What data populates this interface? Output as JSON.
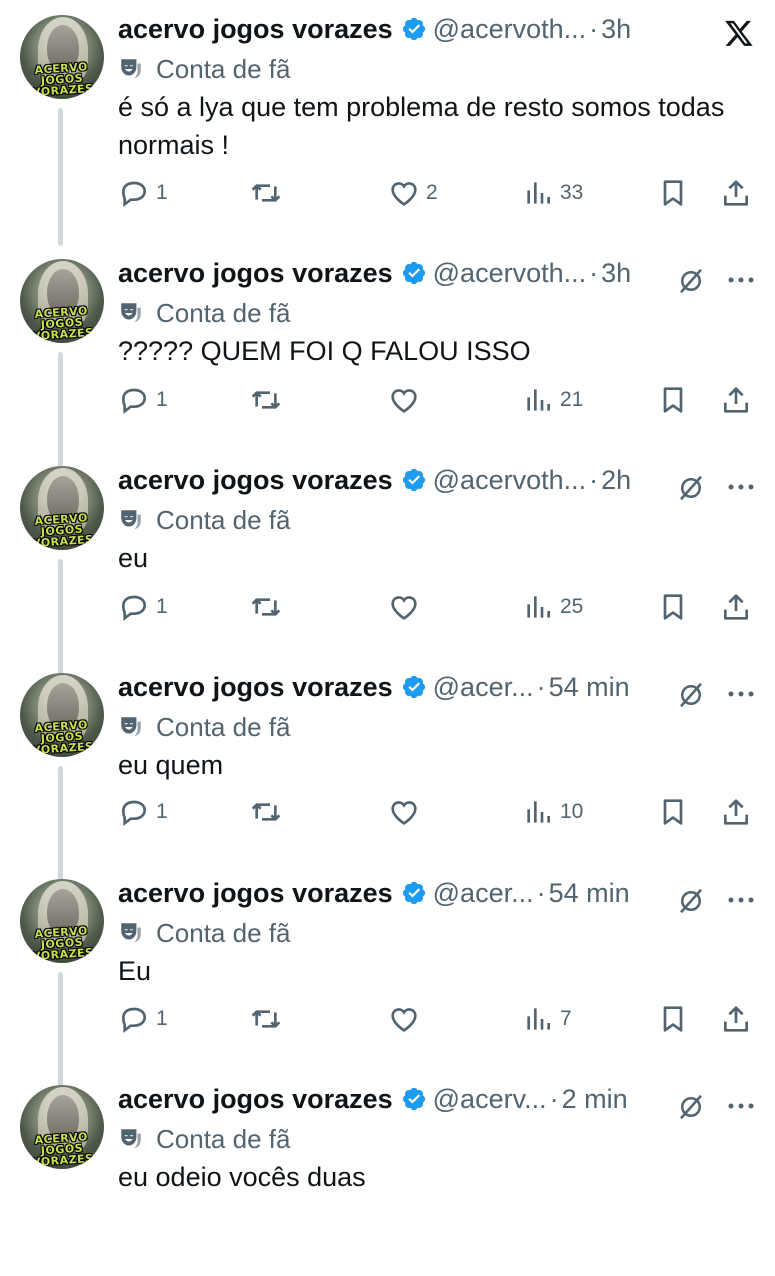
{
  "tweets": [
    {
      "name": "acervo jogos vorazes",
      "handle": "@acervoth...",
      "time": "3h",
      "fan_label": "Conta de fã",
      "text": "é só a lya que tem problema de resto somos todas normais !",
      "replies": "1",
      "reposts": "",
      "likes": "2",
      "views": "33",
      "corner_icon": "x-logo-icon",
      "avatar_text": "ACERVO JOGOS VORAZES"
    },
    {
      "name": "acervo jogos vorazes",
      "handle": "@acervoth...",
      "time": "3h",
      "fan_label": "Conta de fã",
      "text": "????? QUEM FOI Q FALOU ISSO",
      "replies": "1",
      "reposts": "",
      "likes": "",
      "views": "21",
      "corner_icon": "grok-icon",
      "avatar_text": "ACERVO JOGOS VORAZES"
    },
    {
      "name": "acervo jogos vorazes",
      "handle": "@acervoth...",
      "time": "2h",
      "fan_label": "Conta de fã",
      "text": "eu",
      "replies": "1",
      "reposts": "",
      "likes": "",
      "views": "25",
      "corner_icon": "grok-icon",
      "avatar_text": "ACERVO JOGOS VORAZES"
    },
    {
      "name": "acervo jogos vorazes",
      "handle": "@acer...",
      "time": "54 min",
      "fan_label": "Conta de fã",
      "text": "eu quem",
      "replies": "1",
      "reposts": "",
      "likes": "",
      "views": "10",
      "corner_icon": "grok-icon",
      "avatar_text": "ACERVO JOGOS VORAZES"
    },
    {
      "name": "acervo jogos vorazes",
      "handle": "@acer...",
      "time": "54 min",
      "fan_label": "Conta de fã",
      "text": "Eu",
      "replies": "1",
      "reposts": "",
      "likes": "",
      "views": "7",
      "corner_icon": "grok-icon",
      "avatar_text": "ACERVO JOGOS VORAZES"
    },
    {
      "name": "acervo jogos vorazes",
      "handle": "@acerv...",
      "time": "2 min",
      "fan_label": "Conta de fã",
      "text": "eu odeio vocês duas",
      "replies": "",
      "reposts": "",
      "likes": "",
      "views": "",
      "corner_icon": "grok-icon",
      "avatar_text": "ACERVO JOGOS VORAZES"
    }
  ],
  "colors": {
    "verified": "#1d9bf0",
    "secondary_text": "#536471",
    "rail": "#cfd9de"
  }
}
